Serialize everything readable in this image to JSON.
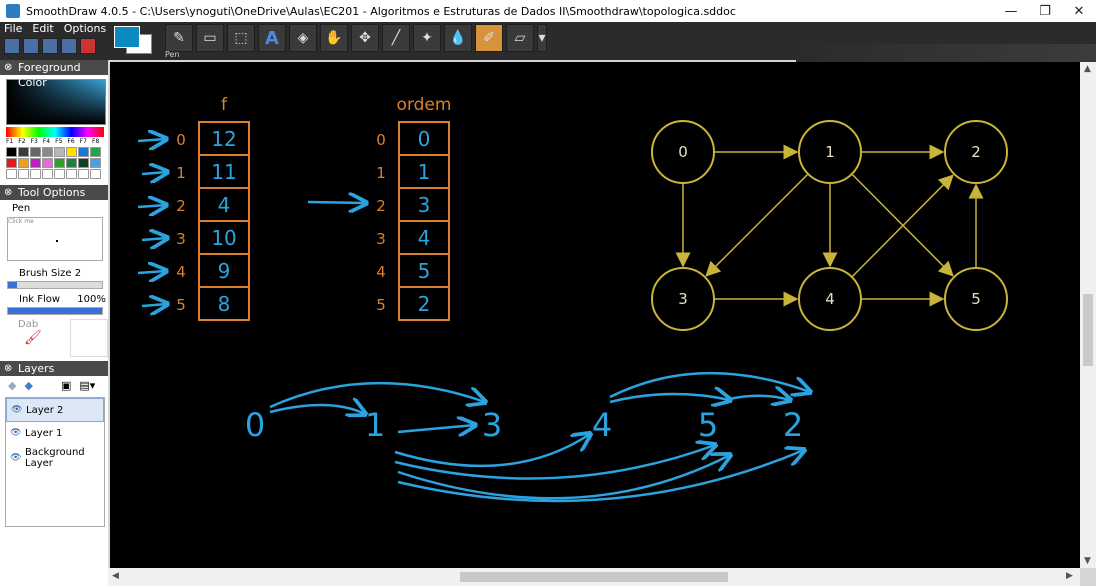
{
  "window": {
    "title": "SmoothDraw 4.0.5 - C:\\Users\\ynoguti\\OneDrive\\Aulas\\EC201 - Algoritmos e Estruturas de Dados II\\Smoothdraw\\topologica.sddoc",
    "minimize": "—",
    "maximize": "❐",
    "close": "✕"
  },
  "menu": {
    "file": "File",
    "edit": "Edit",
    "options": "Options"
  },
  "toolbar": {
    "active_tool_caption": "Pen",
    "colors": {
      "foreground": "#0a8ac0",
      "background": "#ffffff"
    }
  },
  "sidebar": {
    "foreground_header": "Foreground Color",
    "fkeys": [
      "F1",
      "F2",
      "F3",
      "F4",
      "F5",
      "F6",
      "F7",
      "F8"
    ],
    "palette": [
      "#000000",
      "#3a3a3a",
      "#666666",
      "#8a8a8a",
      "#b8b8b8",
      "#ffe000",
      "#1a78d0",
      "#1aa84a",
      "#e01a1a",
      "#f0a020",
      "#c020c0",
      "#e070d0",
      "#30a030",
      "#208040",
      "#104028",
      "#4aa0e0",
      "#ffffff",
      "#ffffff",
      "#ffffff",
      "#ffffff",
      "#ffffff",
      "#ffffff",
      "#ffffff",
      "#ffffff"
    ],
    "tool_options_header": "Tool Options",
    "tool_name": "Pen",
    "preview_hint": "Click me",
    "brush_size_label": "Brush Size",
    "brush_size_value": "2",
    "brush_size_fraction": 0.1,
    "ink_flow_label": "Ink Flow",
    "ink_flow_value": "100%",
    "ink_flow_fraction": 1.0,
    "dab_label": "Dab",
    "layers_header": "Layers",
    "layers": [
      "Layer 2",
      "Layer 1",
      "Background Layer"
    ],
    "selected_layer": "Layer 2"
  },
  "canvas": {
    "table_f": {
      "header": "f",
      "indices": [
        "0",
        "1",
        "2",
        "3",
        "4",
        "5"
      ],
      "values": [
        "12",
        "11",
        "4",
        "10",
        "9",
        "8"
      ]
    },
    "table_ordem": {
      "header": "ordem",
      "indices": [
        "0",
        "1",
        "2",
        "3",
        "4",
        "5"
      ],
      "values": [
        "0",
        "1",
        "3",
        "4",
        "5",
        "2"
      ]
    },
    "graph_nodes": [
      "0",
      "1",
      "2",
      "3",
      "4",
      "5"
    ],
    "graph_edges": [
      [
        "0",
        "1"
      ],
      [
        "1",
        "2"
      ],
      [
        "0",
        "3"
      ],
      [
        "1",
        "3"
      ],
      [
        "1",
        "4"
      ],
      [
        "1",
        "5"
      ],
      [
        "3",
        "4"
      ],
      [
        "4",
        "5"
      ],
      [
        "4",
        "2"
      ],
      [
        "5",
        "2"
      ]
    ],
    "sequence": [
      "0",
      "1",
      "3",
      "4",
      "5",
      "2"
    ],
    "colors": {
      "table": "#d9822b",
      "graph": "#c9b43a",
      "ink": "#2aa3e0"
    }
  }
}
